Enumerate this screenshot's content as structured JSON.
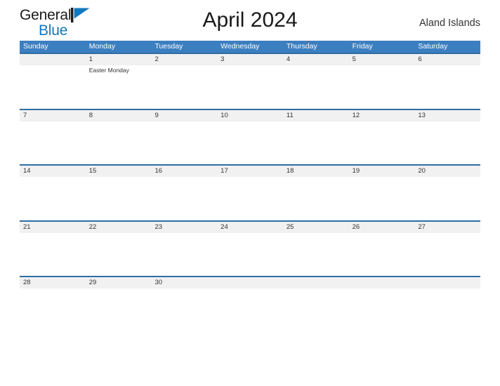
{
  "brand": {
    "name_part1": "General",
    "name_part2": "Blue",
    "flag_icon": "blue-flag-icon",
    "color_dark": "#1a1a1a",
    "color_blue": "#1278bd"
  },
  "header": {
    "title": "April 2024",
    "region": "Aland Islands"
  },
  "theme": {
    "header_blue": "#3c7fc0",
    "divider_blue": "#2e6da4",
    "band_gray": "#f1f1f1",
    "text_dark": "#333333"
  },
  "calendar": {
    "weekdays": [
      "Sunday",
      "Monday",
      "Tuesday",
      "Wednesday",
      "Thursday",
      "Friday",
      "Saturday"
    ],
    "weeks": [
      {
        "days": [
          {
            "num": "",
            "event": ""
          },
          {
            "num": "1",
            "event": "Easter Monday"
          },
          {
            "num": "2",
            "event": ""
          },
          {
            "num": "3",
            "event": ""
          },
          {
            "num": "4",
            "event": ""
          },
          {
            "num": "5",
            "event": ""
          },
          {
            "num": "6",
            "event": ""
          }
        ]
      },
      {
        "days": [
          {
            "num": "7",
            "event": ""
          },
          {
            "num": "8",
            "event": ""
          },
          {
            "num": "9",
            "event": ""
          },
          {
            "num": "10",
            "event": ""
          },
          {
            "num": "11",
            "event": ""
          },
          {
            "num": "12",
            "event": ""
          },
          {
            "num": "13",
            "event": ""
          }
        ]
      },
      {
        "days": [
          {
            "num": "14",
            "event": ""
          },
          {
            "num": "15",
            "event": ""
          },
          {
            "num": "16",
            "event": ""
          },
          {
            "num": "17",
            "event": ""
          },
          {
            "num": "18",
            "event": ""
          },
          {
            "num": "19",
            "event": ""
          },
          {
            "num": "20",
            "event": ""
          }
        ]
      },
      {
        "days": [
          {
            "num": "21",
            "event": ""
          },
          {
            "num": "22",
            "event": ""
          },
          {
            "num": "23",
            "event": ""
          },
          {
            "num": "24",
            "event": ""
          },
          {
            "num": "25",
            "event": ""
          },
          {
            "num": "26",
            "event": ""
          },
          {
            "num": "27",
            "event": ""
          }
        ]
      },
      {
        "days": [
          {
            "num": "28",
            "event": ""
          },
          {
            "num": "29",
            "event": ""
          },
          {
            "num": "30",
            "event": ""
          },
          {
            "num": "",
            "event": ""
          },
          {
            "num": "",
            "event": ""
          },
          {
            "num": "",
            "event": ""
          },
          {
            "num": "",
            "event": ""
          }
        ]
      }
    ]
  }
}
